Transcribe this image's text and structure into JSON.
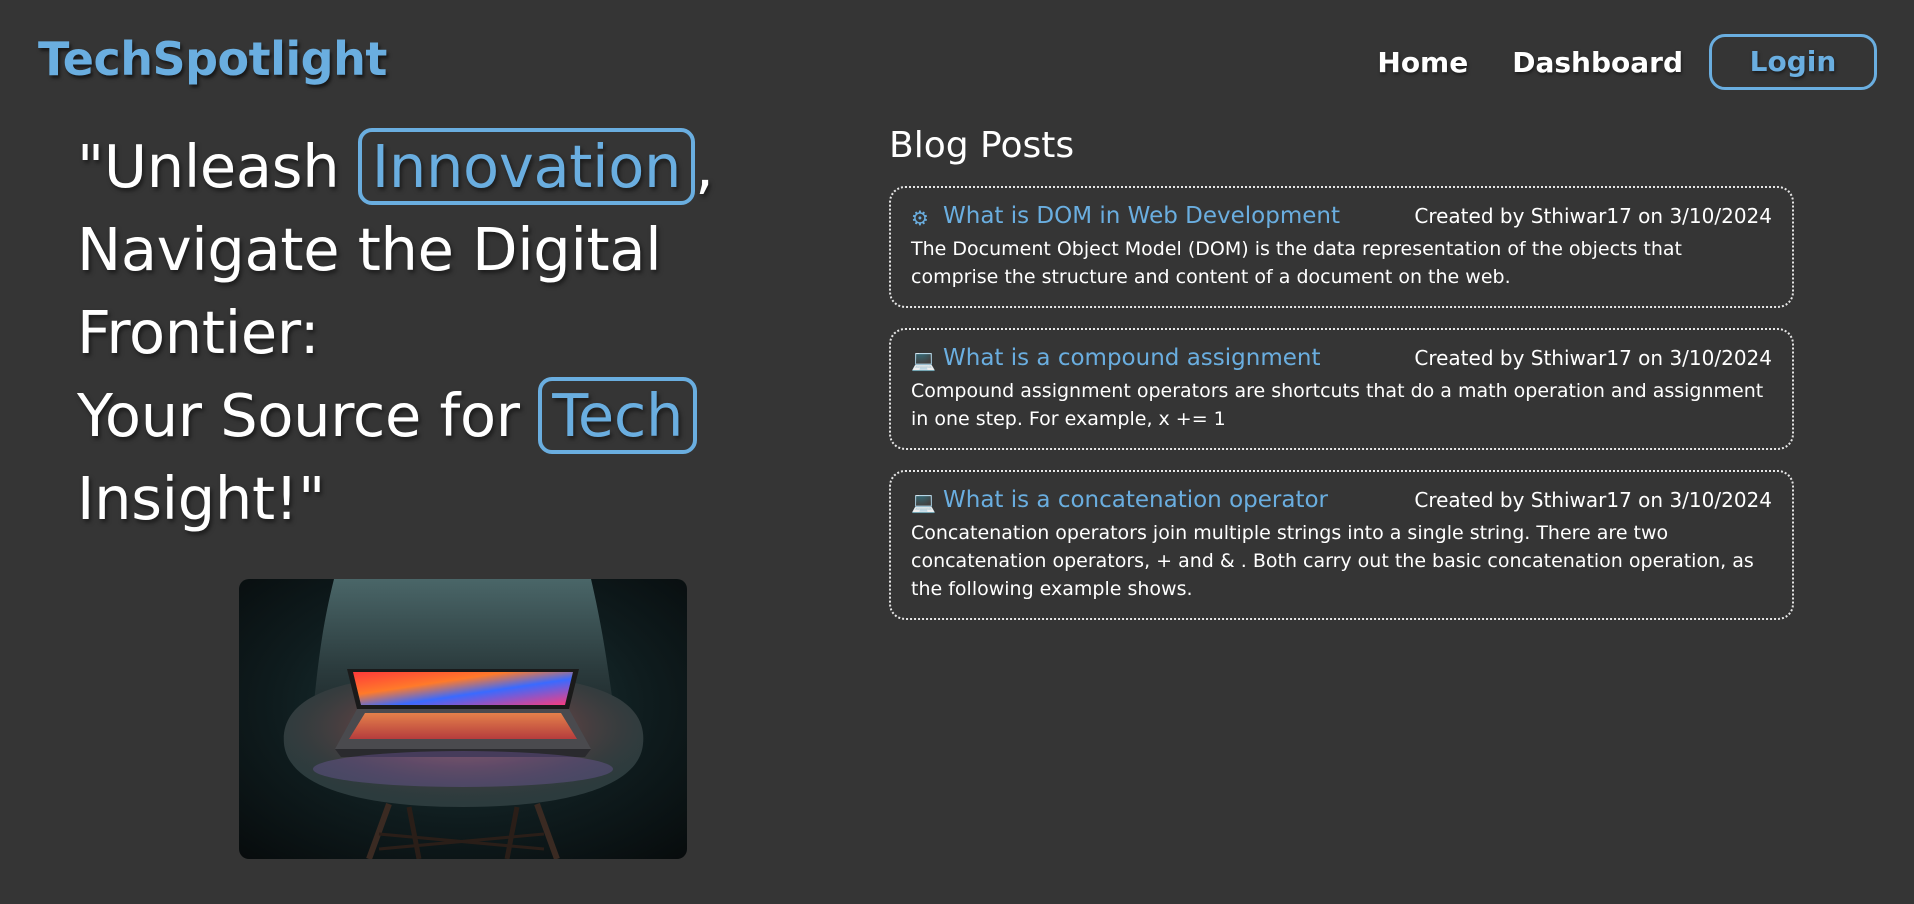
{
  "header": {
    "brand": "TechSpotlight",
    "nav": {
      "home": "Home",
      "dashboard": "Dashboard",
      "login": "Login"
    }
  },
  "hero": {
    "line1_pre": "\"Unleash ",
    "line1_highlight": "Innovation",
    "line1_post": ",",
    "line2": "Navigate the Digital",
    "line3": "Frontier:",
    "line4_pre": "Your Source for ",
    "line4_highlight": "Tech",
    "line5": "Insight!\""
  },
  "blog": {
    "heading": "Blog Posts",
    "posts": [
      {
        "icon": "gear-icon",
        "title": "What is DOM in Web Development",
        "meta": "Created by Sthiwar17 on 3/10/2024",
        "body": "The Document Object Model (DOM) is the data representation of the objects that comprise the structure and content of a document on the web."
      },
      {
        "icon": "laptop-icon",
        "title": "What is a compound assignment",
        "meta": "Created by Sthiwar17 on 3/10/2024",
        "body": "Compound assignment operators are shortcuts that do a math operation and assignment in one step. For example, x += 1"
      },
      {
        "icon": "laptop-icon",
        "title": "What is a concatenation operator",
        "meta": "Created by Sthiwar17 on 3/10/2024",
        "body": "Concatenation operators join multiple strings into a single string. There are two concatenation operators, + and & . Both carry out the basic concatenation operation, as the following example shows."
      }
    ]
  },
  "colors": {
    "background": "#353535",
    "accent": "#6aaee0",
    "text": "#ffffff"
  }
}
